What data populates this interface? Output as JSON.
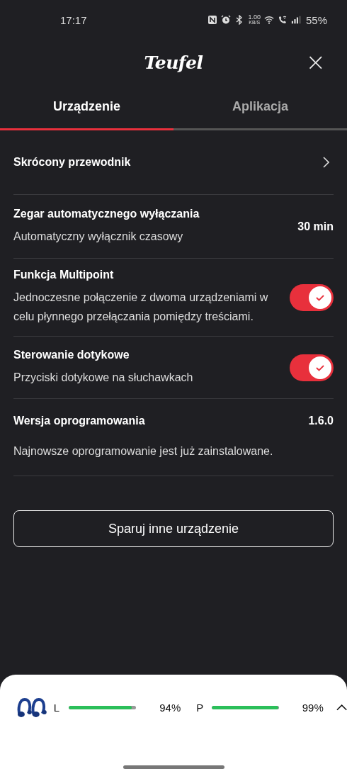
{
  "status_bar": {
    "time": "17:17",
    "speed_value": "1.00",
    "speed_unit": "KB/S",
    "battery": "55%"
  },
  "header": {
    "logo": "Teufel",
    "close": "×"
  },
  "tabs": [
    {
      "label": "Urządzenie",
      "selected": true
    },
    {
      "label": "Aplikacja",
      "selected": false
    }
  ],
  "settings": [
    {
      "kind": "link",
      "title": "Skrócony przewodnik"
    },
    {
      "kind": "value",
      "title": "Zegar automatycznego wyłączania",
      "subtitle": "Automatyczny wyłącznik czasowy",
      "value": "30 min"
    },
    {
      "kind": "toggle",
      "title": "Funkcja Multipoint",
      "subtitle": "Jednoczesne połączenie z dwoma urządzeniami w celu płynnego przełączania pomiędzy treściami.",
      "on": true
    },
    {
      "kind": "toggle",
      "title": "Sterowanie dotykowe",
      "subtitle": "Przyciski dotykowe na słuchawkach",
      "on": true
    },
    {
      "kind": "info",
      "title": "Wersja oprogramowania",
      "value": "1.6.0",
      "note": "Najnowsze oprogramowanie jest już zainstalowane."
    }
  ],
  "pair_button": "Sparuj inne urządzenie",
  "battery_sheet": {
    "earbuds": [
      {
        "side": "L",
        "level": 0.94,
        "percent": "94%"
      },
      {
        "side": "P",
        "level": 0.99,
        "percent": "99%"
      }
    ]
  }
}
